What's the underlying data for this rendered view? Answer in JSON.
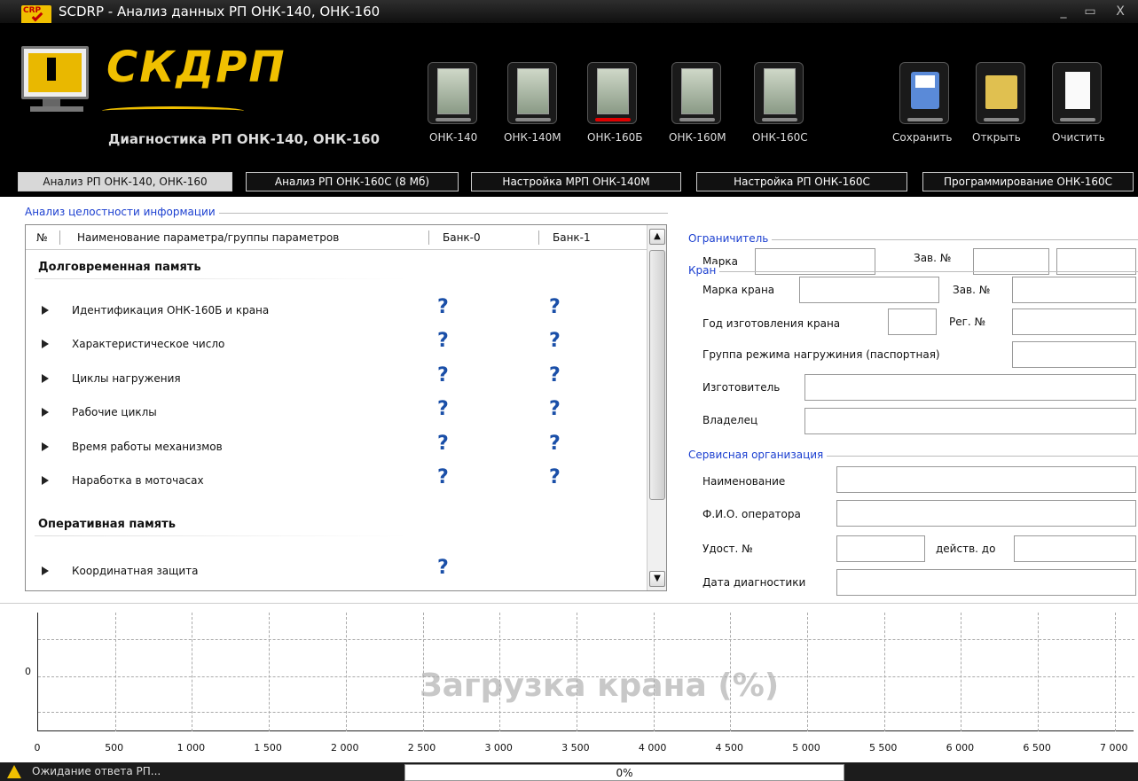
{
  "window": {
    "app_icon": "CRP",
    "title": "SCDRP - Анализ данных РП ОНК-140, ОНК-160",
    "minimize": "_",
    "maximize": "▭",
    "close": "X"
  },
  "banner": {
    "logo": "СКДРП",
    "subtitle": "Диагностика РП ОНК-140, ОНК-160",
    "devices": [
      {
        "label": "ОНК-140"
      },
      {
        "label": "ОНК-140М"
      },
      {
        "label": "ОНК-160Б",
        "active": true
      },
      {
        "label": "ОНК-160М"
      },
      {
        "label": "ОНК-160С"
      }
    ],
    "actions": {
      "save": "Сохранить",
      "open": "Открыть",
      "clear": "Очистить"
    }
  },
  "tabs": [
    {
      "label": "Анализ РП ОНК-140, ОНК-160",
      "active": true
    },
    {
      "label": "Анализ РП ОНК-160С (8 Мб)"
    },
    {
      "label": "Настройка МРП ОНК-140М"
    },
    {
      "label": "Настройка РП ОНК-160С"
    },
    {
      "label": "Программирование ОНК-160С"
    }
  ],
  "integrity": {
    "legend": "Анализ целостности информации",
    "columns": [
      "№",
      "Наименование параметра/группы параметров",
      "Банк-0",
      "Банк-1"
    ],
    "sections": [
      {
        "title": "Долговременная память",
        "rows": [
          {
            "label": "Идентификация ОНК-160Б и крана",
            "bank0": "?",
            "bank1": "?"
          },
          {
            "label": "Характеристическое число",
            "bank0": "?",
            "bank1": "?"
          },
          {
            "label": "Циклы нагружения",
            "bank0": "?",
            "bank1": "?"
          },
          {
            "label": "Рабочие циклы",
            "bank0": "?",
            "bank1": "?"
          },
          {
            "label": "Время работы механизмов",
            "bank0": "?",
            "bank1": "?"
          },
          {
            "label": "Наработка в моточасах",
            "bank0": "?",
            "bank1": "?"
          }
        ]
      },
      {
        "title": "Оперативная память",
        "rows": [
          {
            "label": "Координатная защита",
            "bank0": "?",
            "bank1": ""
          }
        ]
      }
    ],
    "scroll_up": "▲",
    "scroll_down": "▼"
  },
  "limiter": {
    "legend": "Ограничитель",
    "brand_label": "Марка",
    "brand_value": "",
    "serial_label": "Зав. №",
    "serial_value": "",
    "extra_value": ""
  },
  "crane": {
    "legend": "Кран",
    "brand_label": "Марка крана",
    "brand_value": "",
    "serial_label": "Зав. №",
    "serial_value": "",
    "year_label": "Год изготовления крана",
    "year_value": "",
    "reg_label": "Рег. №",
    "reg_value": "",
    "load_group_label": "Группа режима нагружиния (паспортная)",
    "load_group_value": "",
    "maker_label": "Изготовитель",
    "maker_value": "",
    "owner_label": "Владелец",
    "owner_value": ""
  },
  "service": {
    "legend": "Сервисная организация",
    "name_label": "Наименование",
    "name_value": "",
    "operator_label": "Ф.И.О. оператора",
    "operator_value": "",
    "cert_label": "Удост. №",
    "cert_value": "",
    "valid_label": "действ. до",
    "valid_value": "",
    "date_label": "Дата диагностики",
    "date_value": ""
  },
  "chart_data": {
    "type": "line",
    "title": "Загрузка крана (%)",
    "x_ticks": [
      "0",
      "500",
      "1 000",
      "1 500",
      "2 000",
      "2 500",
      "3 000",
      "3 500",
      "4 000",
      "4 500",
      "5 000",
      "5 500",
      "6 000",
      "6 500",
      "7 000"
    ],
    "y_ticks": [
      "0"
    ],
    "xlim": [
      0,
      7000
    ],
    "grid": true,
    "series": []
  },
  "status": {
    "icon": "warning-icon",
    "text": "Ожидание ответа РП...",
    "progress_text": "0%",
    "progress_value": 0
  }
}
